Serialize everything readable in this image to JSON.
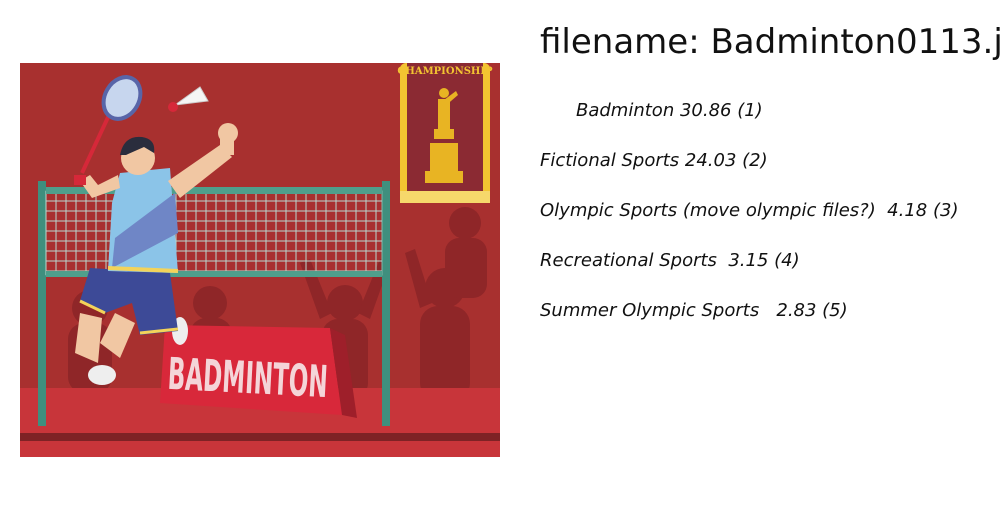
{
  "filename_line": "filename: Badminton0113.jp",
  "illustration": {
    "banner_text": "CHAMPIONSHIP",
    "sign_text": "BADMINTON",
    "colors": {
      "background": "#a8302f",
      "floor": "#c8353a",
      "net_post": "#3f8f7e",
      "banner": "#f3c431",
      "trophy": "#e8b423",
      "shirt": "#8bc4e8",
      "shorts": "#3d4a97"
    }
  },
  "predictions": [
    "Badminton 30.86 (1)",
    "Fictional Sports 24.03 (2)",
    "Olympic Sports (move olympic files?)  4.18 (3)",
    "Recreational Sports  3.15 (4)",
    "Summer Olympic Sports   2.83 (5)"
  ]
}
